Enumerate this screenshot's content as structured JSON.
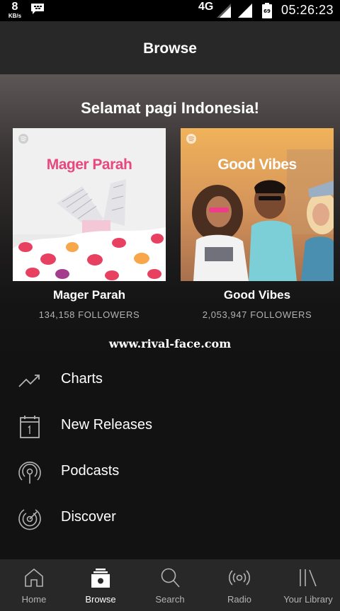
{
  "status_bar": {
    "speed_value": "8",
    "speed_unit": "KB/s",
    "network": "4G",
    "time": "05:26:23",
    "battery_level": "69"
  },
  "header": {
    "title": "Browse"
  },
  "greeting": "Selamat pagi Indonesia!",
  "playlists": [
    {
      "cover_title": "Mager Parah",
      "name": "Mager Parah",
      "followers": "134,158 FOLLOWERS",
      "accent": "#e8487f"
    },
    {
      "cover_title": "Good Vibes",
      "name": "Good Vibes",
      "followers": "2,053,947 FOLLOWERS",
      "accent": "#ffffff"
    }
  ],
  "watermark": "www.rival-face.com",
  "menu": [
    {
      "label": "Charts",
      "icon": "chart-trend-icon"
    },
    {
      "label": "New Releases",
      "icon": "calendar-icon"
    },
    {
      "label": "Podcasts",
      "icon": "podcast-icon"
    },
    {
      "label": "Discover",
      "icon": "discover-icon"
    }
  ],
  "bottom_nav": [
    {
      "label": "Home",
      "icon": "home-icon",
      "active": false
    },
    {
      "label": "Browse",
      "icon": "browse-icon",
      "active": true
    },
    {
      "label": "Search",
      "icon": "search-icon",
      "active": false
    },
    {
      "label": "Radio",
      "icon": "radio-icon",
      "active": false
    },
    {
      "label": "Your Library",
      "icon": "library-icon",
      "active": false
    }
  ],
  "colors": {
    "background": "#121212",
    "header": "#282828",
    "nav": "#282828",
    "secondary_text": "#b3b3b3"
  }
}
